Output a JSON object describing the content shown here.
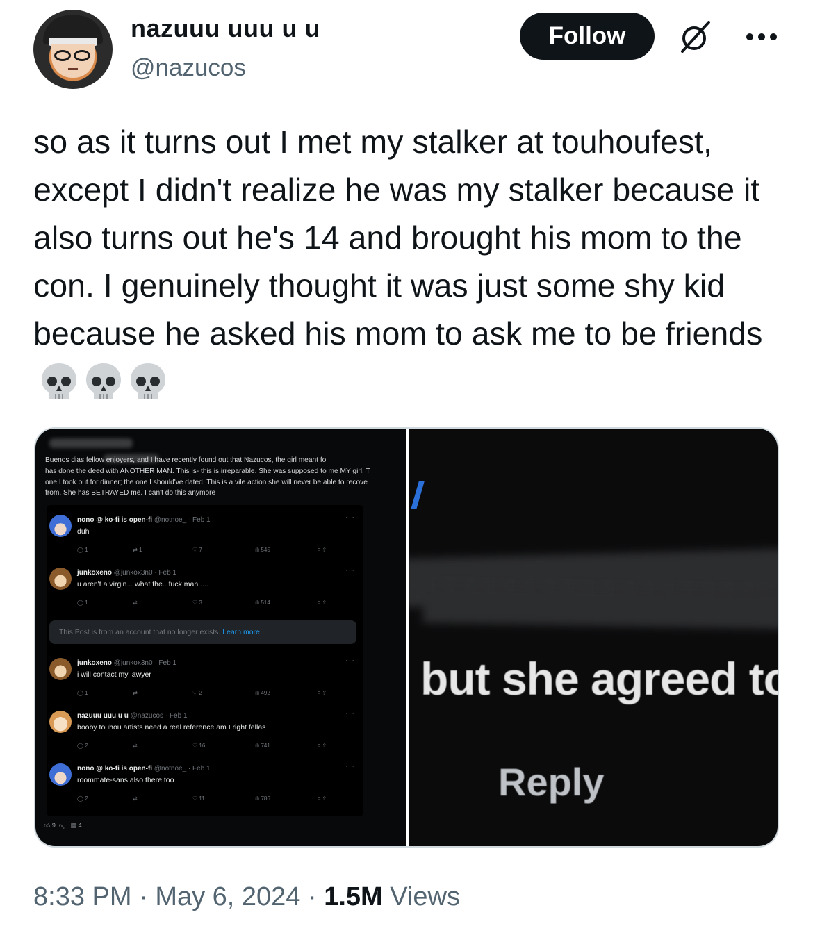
{
  "user": {
    "name": "nazuuu uuu u u",
    "handle": "@nazucos",
    "follow_label": "Follow"
  },
  "tweet": {
    "text": "so as it turns out I met my stalker at touhoufest, except I didn't realize he was my stalker because it also turns out he's 14 and brought his mom to the con. I genuinely thought it was just some shy kid because he asked his mom to ask me to be friends"
  },
  "media_left": {
    "post_text": "Buenos dias fellow                    enjoyers, and I have recently found out that Nazucos, the girl meant fo\nhas done the deed with ANOTHER MAN. This is- this is irreparable. She was supposed to me MY girl. T\none I took out for dinner; the one I should've dated. This is a vile action she will never be able to recove\nfrom. She has BETRAYED me. I can't do this anymore",
    "replies": [
      {
        "name": "nono @ ko-fi is open-fi",
        "meta": "@notnoe_ · Feb 1",
        "text": "duh",
        "stats": {
          "replies": "1",
          "reposts": "1",
          "likes": "7",
          "views": "545"
        }
      },
      {
        "name": "junkoxeno",
        "meta": "@junkox3n0 · Feb 1",
        "text": "u aren't a virgin... what the.. fuck man.....",
        "stats": {
          "replies": "1",
          "reposts": "",
          "likes": "3",
          "views": "514"
        }
      },
      {
        "name": "junkoxeno",
        "meta": "@junkox3n0 · Feb 1",
        "text": "i will contact my lawyer",
        "stats": {
          "replies": "1",
          "reposts": "",
          "likes": "2",
          "views": "492"
        }
      },
      {
        "name": "nazuuu uuu u u",
        "meta": "@nazucos · Feb 1",
        "text": "booby touhou artists need a real reference am I right fellas",
        "stats": {
          "replies": "2",
          "reposts": "",
          "likes": "16",
          "views": "741"
        }
      },
      {
        "name": "nono @ ko-fi is open-fi",
        "meta": "@notnoe_ · Feb 1",
        "text": "roommate-sans also there too",
        "stats": {
          "replies": "2",
          "reposts": "",
          "likes": "11",
          "views": "786"
        }
      }
    ],
    "removed_notice": "This Post is from an account that no longer exists.",
    "removed_link": "Learn more",
    "vote_bar": {
      "upvotes": "9",
      "comments": "4"
    }
  },
  "media_right": {
    "caption": "but she agreed to",
    "reply_label": "Reply"
  },
  "footer": {
    "time": "8:33 PM",
    "date": "May 6, 2024",
    "views_count": "1.5M",
    "views_label": "Views"
  }
}
